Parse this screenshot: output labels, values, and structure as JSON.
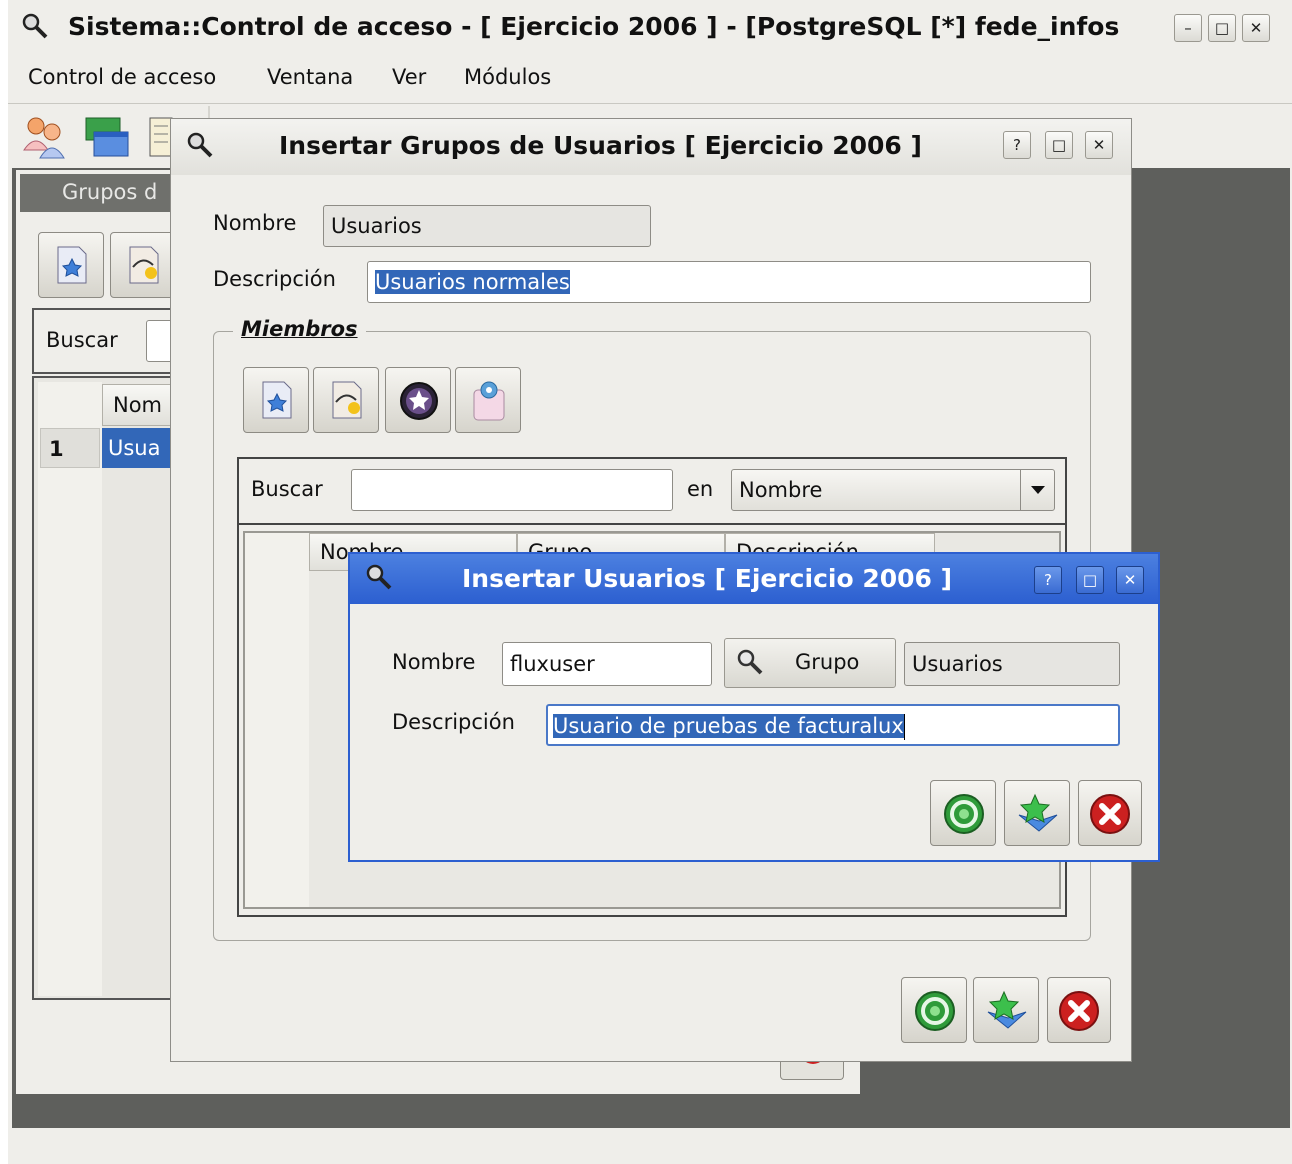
{
  "main_window": {
    "title": "Sistema::Control de acceso  - [ Ejercicio 2006 ] - [PostgreSQL [*] fede_infos",
    "menu": [
      "Control de acceso",
      "Ventana",
      "Ver",
      "Módulos"
    ]
  },
  "bg_panel": {
    "title": "Grupos d",
    "search_label": "Buscar",
    "column_header": "Nom",
    "row_number": "1",
    "row_value": "Usua"
  },
  "group_dialog": {
    "title": "Insertar Grupos de Usuarios [ Ejercicio 2006 ]",
    "nombre_label": "Nombre",
    "nombre_value": "Usuarios",
    "descripcion_label": "Descripción",
    "descripcion_value": "Usuarios normales",
    "miembros_label": "Miembros",
    "buscar_label": "Buscar",
    "buscar_value": "",
    "en_label": "en",
    "en_select_value": "Nombre",
    "columns": [
      "Nombre",
      "Grupo",
      "Descripción"
    ]
  },
  "user_dialog": {
    "title": "Insertar Usuarios [ Ejercicio 2006 ]",
    "nombre_label": "Nombre",
    "nombre_value": "fluxuser",
    "grupo_button": "Grupo",
    "grupo_value": "Usuarios",
    "descripcion_label": "Descripción",
    "descripcion_value": "Usuario de pruebas de facturalux"
  },
  "colors": {
    "dialog_bg": "#efeeea",
    "dark_workspace": "#5e5f5c",
    "active_titlebar": "#2c5fd0",
    "selection": "#3267b8",
    "accept_green": "#2f9b3a",
    "cancel_red": "#cc2020"
  },
  "icons": [
    "magnifier-icon",
    "users-icon",
    "windows-icon",
    "notes-icon",
    "new-document-icon",
    "edit-document-icon",
    "delete-icon",
    "view-icon",
    "accept-icon",
    "accept-continue-icon",
    "cancel-icon"
  ]
}
